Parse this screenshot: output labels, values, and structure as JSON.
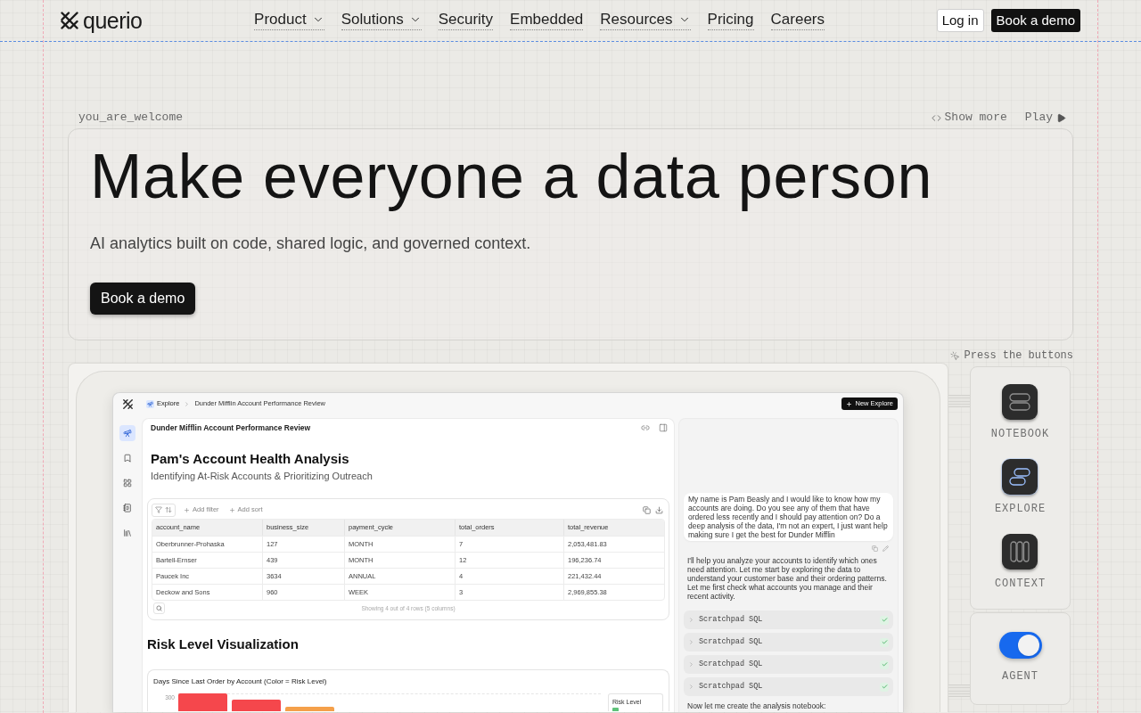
{
  "nav": {
    "logo": "querio",
    "links": [
      {
        "label": "Product",
        "dropdown": true
      },
      {
        "label": "Solutions",
        "dropdown": true
      },
      {
        "label": "Security",
        "dropdown": false
      },
      {
        "label": "Embedded",
        "dropdown": false
      },
      {
        "label": "Resources",
        "dropdown": true
      },
      {
        "label": "Pricing",
        "dropdown": false
      },
      {
        "label": "Careers",
        "dropdown": false
      }
    ],
    "buttons": [
      {
        "label": "Log in",
        "kind": "secondary"
      },
      {
        "label": "Book a demo",
        "kind": "primary"
      }
    ]
  },
  "hero": {
    "eyebrow": "you_are_welcome",
    "actions": [
      {
        "label": "Show more",
        "kind": "code"
      },
      {
        "label": "Play",
        "kind": "play"
      }
    ],
    "title": "Make everyone a data person",
    "subtitle": "AI analytics built on code, shared logic, and governed context.",
    "cta": "Book a demo"
  },
  "demo": {
    "hint": "Press the buttons",
    "app": {
      "breadcrumb": [
        "Explore",
        "Dunder Mifflin Account Performance Review"
      ],
      "new_button": "New Explore",
      "sidebar": [
        {
          "kind": "explore",
          "selected": true
        },
        {
          "kind": "bookmark",
          "selected": false
        },
        {
          "kind": "grid",
          "selected": false
        },
        {
          "kind": "notebook",
          "selected": false
        },
        {
          "kind": "library",
          "selected": false
        }
      ],
      "document": {
        "header": "Dunder Mifflin Account Performance Review",
        "title": "Pam's Account Health Analysis",
        "subtitle": "Identifying At-Risk Accounts & Prioritizing Outreach",
        "table": {
          "toolbar": [
            "Add filter",
            "Add sort"
          ],
          "columns": [
            "account_name",
            "business_size",
            "payment_cycle",
            "total_orders",
            "total_revenue"
          ],
          "rows": [
            [
              "Oberbrunner-Prohaska",
              "127",
              "MONTH",
              "7",
              "2,053,481.83"
            ],
            [
              "Bartell-Ernser",
              "439",
              "MONTH",
              "12",
              "196,236.74"
            ],
            [
              "Paucek Inc",
              "3634",
              "ANNUAL",
              "4",
              "221,432.44"
            ],
            [
              "Deckow and Sons",
              "960",
              "WEEK",
              "3",
              "2,969,855.38"
            ]
          ],
          "footer": "Showing 4 out of 4 rows (5 columns)"
        },
        "section_title": "Risk Level Visualization",
        "chart": {
          "title": "Days Since Last Order by Account (Color = Risk Level)",
          "y_tick": "300",
          "bars": [
            {
              "color": "#f5474c"
            },
            {
              "color": "#f5474c"
            },
            {
              "color": "#f5a04a"
            }
          ],
          "legend_title": "Risk Level"
        }
      },
      "chat": {
        "user_message": "My name is Pam Beasly and I would like to know how my accounts are doing. Do you see any of them that have ordered less recently and I should pay attention on? Do a deep analysis of the data, I'm not an expert, I just want help making sure I get the best for Dunder Mifflin",
        "assistant_message": [
          "I'll help you analyze your accounts to identify which ones need attention. Let me start by exploring the data to understand your customer base and their ordering patterns.",
          "Let me first check what accounts you manage and their recent activity."
        ],
        "tool_calls": [
          {
            "label": "Scratchpad SQL",
            "done": true
          },
          {
            "label": "Scratchpad SQL",
            "done": true
          },
          {
            "label": "Scratchpad SQL",
            "done": true
          },
          {
            "label": "Scratchpad SQL",
            "done": true
          }
        ],
        "follow_up": "Now let me create the analysis notebook:"
      }
    },
    "modes": [
      {
        "label": "NOTEBOOK",
        "kind": "notebook",
        "selected": false
      },
      {
        "label": "EXPLORE",
        "kind": "explore",
        "selected": true
      },
      {
        "label": "CONTEXT",
        "kind": "context",
        "selected": false
      }
    ],
    "agent": {
      "label": "AGENT",
      "on": true
    }
  }
}
